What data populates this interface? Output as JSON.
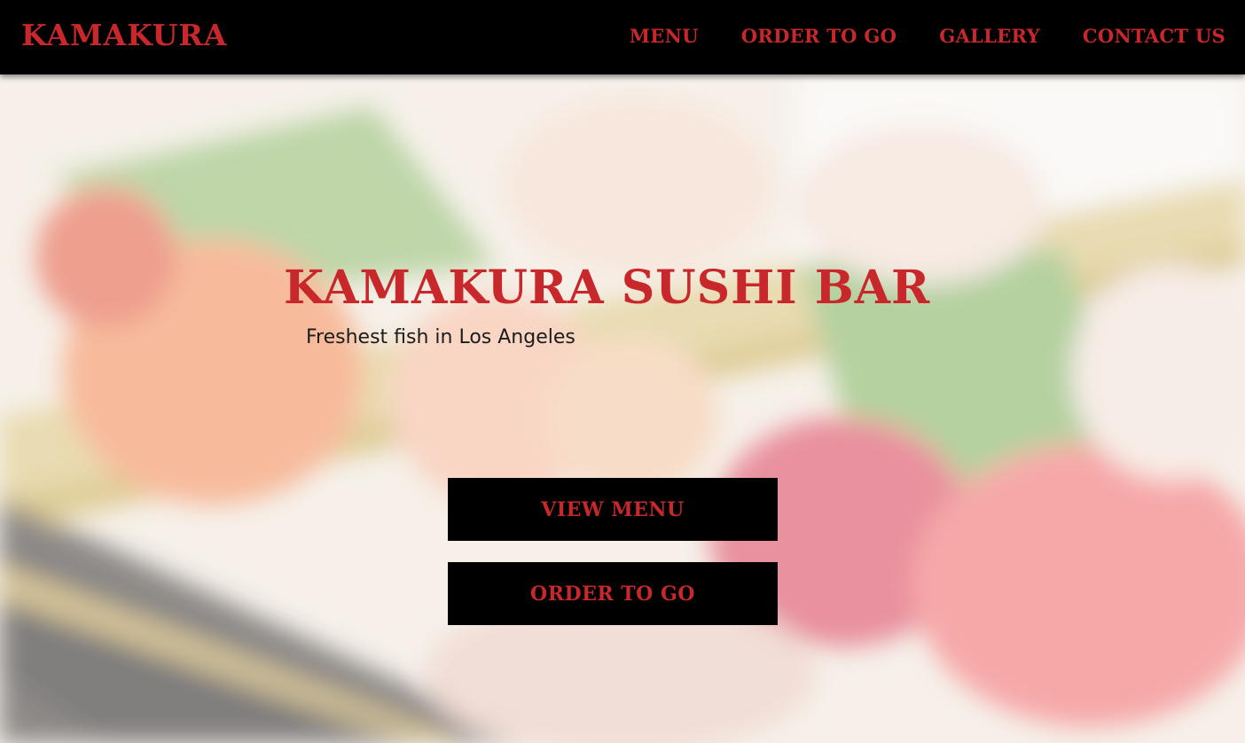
{
  "navbar": {
    "brand": "KAMAKURA",
    "links": [
      {
        "label": "MENU"
      },
      {
        "label": "ORDER TO GO"
      },
      {
        "label": "GALLERY"
      },
      {
        "label": "CONTACT US"
      }
    ]
  },
  "hero": {
    "title": "KAMAKURA SUSHI BAR",
    "subtitle": "Freshest fish in Los Angeles",
    "buttons": {
      "view_menu": "VIEW MENU",
      "order_to_go": "ORDER TO GO"
    }
  },
  "colors": {
    "accent": "#c8282c",
    "nav_background": "#000000",
    "button_background": "#000000",
    "subtitle_text": "#1c1c1c"
  }
}
